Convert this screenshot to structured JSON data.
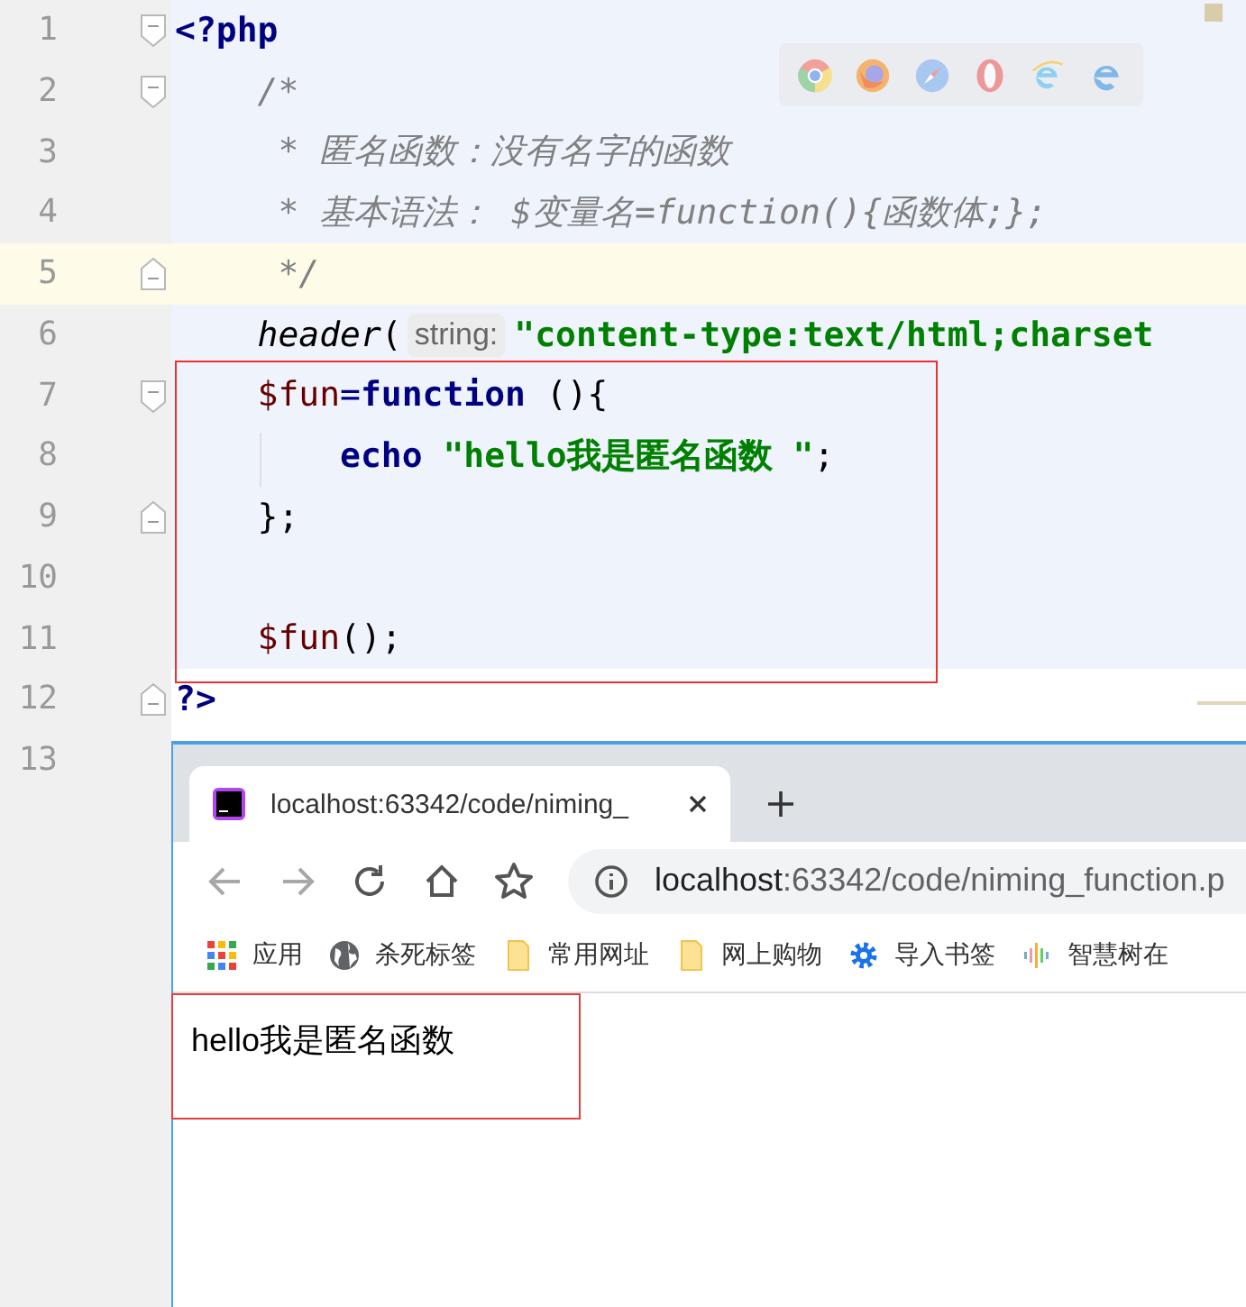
{
  "editor": {
    "browser_icons": [
      {
        "kind": "ring"
      },
      {
        "kind": "fox"
      },
      {
        "kind": "compass"
      },
      {
        "kind": "oval"
      },
      {
        "kind": "swoosh"
      },
      {
        "kind": "letter"
      }
    ],
    "lines": [
      {
        "number": "1",
        "current": false,
        "injected": true,
        "fold_start": true,
        "fold_end": false,
        "tokens": [
          {
            "kind": "keyword",
            "text": "<?php"
          }
        ]
      },
      {
        "number": "2",
        "current": false,
        "injected": true,
        "fold_start": true,
        "fold_end": false,
        "tokens": [
          {
            "kind": "comment",
            "text": "    /*"
          }
        ]
      },
      {
        "number": "3",
        "current": false,
        "injected": true,
        "fold_start": false,
        "fold_end": false,
        "tokens": [
          {
            "kind": "comment",
            "text": "     * 匿名函数：没有名字的函数"
          }
        ]
      },
      {
        "number": "4",
        "current": false,
        "injected": true,
        "fold_start": false,
        "fold_end": false,
        "tokens": [
          {
            "kind": "comment",
            "text": "     * 基本语法： $变量名=function(){函数体;};"
          }
        ]
      },
      {
        "number": "5",
        "current": true,
        "injected": true,
        "fold_start": false,
        "fold_end": true,
        "tokens": [
          {
            "kind": "comment",
            "text": "     */"
          }
        ]
      },
      {
        "number": "6",
        "current": false,
        "injected": true,
        "fold_start": false,
        "fold_end": false,
        "tokens": [
          {
            "kind": "func",
            "text": "    header"
          },
          {
            "kind": "plain",
            "text": "("
          },
          {
            "kind": "hint",
            "text": "string:"
          },
          {
            "kind": "string",
            "text": "\"content-type:text/html;charset"
          }
        ]
      },
      {
        "number": "7",
        "current": false,
        "injected": true,
        "fold_start": true,
        "fold_end": false,
        "tokens": [
          {
            "kind": "var",
            "text": "    $fun"
          },
          {
            "kind": "operator",
            "text": "="
          },
          {
            "kind": "keyword",
            "text": "function"
          },
          {
            "kind": "plain",
            "text": " (){"
          }
        ]
      },
      {
        "number": "8",
        "current": false,
        "injected": true,
        "fold_start": false,
        "fold_end": false,
        "tokens": [
          {
            "kind": "keyword",
            "text": "        echo"
          },
          {
            "kind": "string",
            "text": " \"hello我是匿名函数 \""
          },
          {
            "kind": "plain",
            "text": ";"
          }
        ]
      },
      {
        "number": "9",
        "current": false,
        "injected": true,
        "fold_start": false,
        "fold_end": true,
        "tokens": [
          {
            "kind": "plain",
            "text": "    };"
          }
        ]
      },
      {
        "number": "10",
        "current": false,
        "injected": true,
        "fold_start": false,
        "fold_end": false
      },
      {
        "number": "11",
        "current": false,
        "injected": true,
        "fold_start": false,
        "fold_end": false,
        "tokens": [
          {
            "kind": "var",
            "text": "    $fun"
          },
          {
            "kind": "plain",
            "text": "();"
          }
        ]
      },
      {
        "number": "12",
        "current": false,
        "injected": false,
        "fold_start": false,
        "fold_end": true,
        "tokens": [
          {
            "kind": "keyword",
            "text": "?>"
          }
        ]
      },
      {
        "number": "13",
        "current": false,
        "injected": false,
        "fold_start": false,
        "fold_end": false
      }
    ]
  },
  "browser": {
    "tabs": [
      {
        "title": "localhost:63342/code/niming_",
        "selected": true
      }
    ],
    "nav": [
      {
        "kind": "back",
        "disabled": true
      },
      {
        "kind": "forward",
        "disabled": true
      },
      {
        "kind": "reload",
        "disabled": false
      },
      {
        "kind": "home",
        "disabled": false
      },
      {
        "kind": "star",
        "disabled": false
      }
    ],
    "address": {
      "host": "localhost",
      "path": ":63342/code/niming_function.p"
    },
    "bookmarks": [
      {
        "kind": "apps",
        "label": "应用"
      },
      {
        "kind": "globe",
        "label": "杀死标签"
      },
      {
        "kind": "folder",
        "label": "常用网址"
      },
      {
        "kind": "folder",
        "label": "网上购物"
      },
      {
        "kind": "gear",
        "label": "导入书签"
      },
      {
        "kind": "bars",
        "label": "智慧树在"
      }
    ],
    "page_text": "hello我是匿名函数"
  }
}
